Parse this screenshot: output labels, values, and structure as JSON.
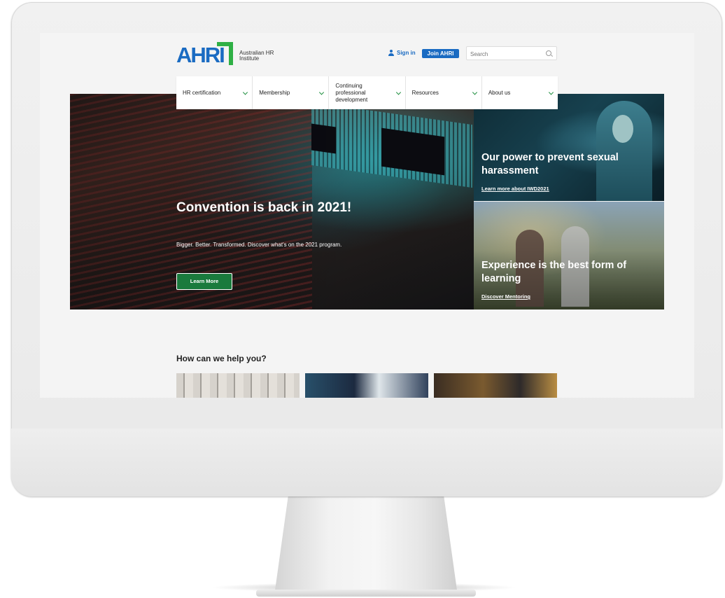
{
  "header": {
    "logo_text": "AHRI",
    "logo_subtitle": "Australian HR Institute",
    "sign_in": "Sign in",
    "join": "Join AHRI",
    "search_placeholder": "Search"
  },
  "nav": {
    "items": [
      {
        "label": "HR certification"
      },
      {
        "label": "Membership"
      },
      {
        "label": "Continuing professional development"
      },
      {
        "label": "Resources"
      },
      {
        "label": "About us"
      }
    ]
  },
  "hero": {
    "title": "Convention is back in 2021!",
    "subtitle": "Bigger. Better. Transformed. Discover what's on the 2021 program.",
    "button": "Learn More"
  },
  "cards": [
    {
      "title": "Our power to prevent sexual harassment",
      "link": "Learn more about IWD2021"
    },
    {
      "title": "Experience is the best form of learning",
      "link": "Discover Mentoring"
    }
  ],
  "help": {
    "title": "How can we help you?"
  },
  "colors": {
    "brand_blue": "#1a6bc2",
    "brand_green": "#2fb045",
    "button_green": "#1a7a3d"
  },
  "icons": [
    "user-icon",
    "search-icon",
    "chevron-down-icon"
  ]
}
